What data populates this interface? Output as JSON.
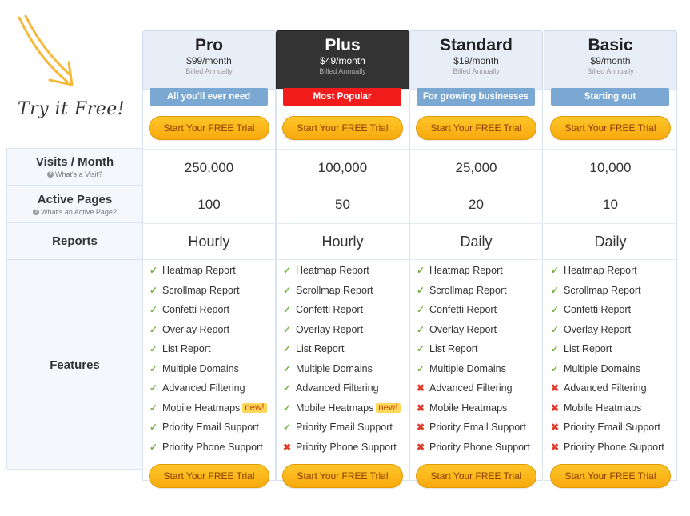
{
  "promo": {
    "text": "Try it Free!"
  },
  "row_labels": {
    "visits": {
      "title": "Visits / Month",
      "help": "What's a Visit?"
    },
    "pages": {
      "title": "Active Pages",
      "help": "What's an Active Page?"
    },
    "reports": {
      "title": "Reports"
    },
    "features": {
      "title": "Features"
    }
  },
  "colors": {
    "accent": "#f7a90d",
    "tagline_blue": "#7aa8d2",
    "popular_red": "#f21c1c",
    "check": "#76b043",
    "cross": "#e33a2b"
  },
  "plans": [
    {
      "name": "Pro",
      "price": "$99/month",
      "billed": "Billed Annually",
      "tagline": "All you'll ever need",
      "cta": "Start Your FREE Trial",
      "visits": "250,000",
      "pages": "100",
      "reports": "Hourly",
      "features": [
        {
          "label": "Heatmap Report",
          "included": true,
          "badge": ""
        },
        {
          "label": "Scrollmap Report",
          "included": true,
          "badge": ""
        },
        {
          "label": "Confetti Report",
          "included": true,
          "badge": ""
        },
        {
          "label": "Overlay Report",
          "included": true,
          "badge": ""
        },
        {
          "label": "List Report",
          "included": true,
          "badge": ""
        },
        {
          "label": "Multiple Domains",
          "included": true,
          "badge": ""
        },
        {
          "label": "Advanced Filtering",
          "included": true,
          "badge": ""
        },
        {
          "label": "Mobile Heatmaps",
          "included": true,
          "badge": "new!"
        },
        {
          "label": "Priority Email Support",
          "included": true,
          "badge": ""
        },
        {
          "label": "Priority Phone Support",
          "included": true,
          "badge": ""
        }
      ]
    },
    {
      "name": "Plus",
      "price": "$49/month",
      "billed": "Billed Annually",
      "tagline": "Most Popular",
      "cta": "Start Your FREE Trial",
      "visits": "100,000",
      "pages": "50",
      "reports": "Hourly",
      "features": [
        {
          "label": "Heatmap Report",
          "included": true,
          "badge": ""
        },
        {
          "label": "Scrollmap Report",
          "included": true,
          "badge": ""
        },
        {
          "label": "Confetti Report",
          "included": true,
          "badge": ""
        },
        {
          "label": "Overlay Report",
          "included": true,
          "badge": ""
        },
        {
          "label": "List Report",
          "included": true,
          "badge": ""
        },
        {
          "label": "Multiple Domains",
          "included": true,
          "badge": ""
        },
        {
          "label": "Advanced Filtering",
          "included": true,
          "badge": ""
        },
        {
          "label": "Mobile Heatmaps",
          "included": true,
          "badge": "new!"
        },
        {
          "label": "Priority Email Support",
          "included": true,
          "badge": ""
        },
        {
          "label": "Priority Phone Support",
          "included": false,
          "badge": ""
        }
      ]
    },
    {
      "name": "Standard",
      "price": "$19/month",
      "billed": "Billed Annually",
      "tagline": "For growing businesses",
      "cta": "Start Your FREE Trial",
      "visits": "25,000",
      "pages": "20",
      "reports": "Daily",
      "features": [
        {
          "label": "Heatmap Report",
          "included": true,
          "badge": ""
        },
        {
          "label": "Scrollmap Report",
          "included": true,
          "badge": ""
        },
        {
          "label": "Confetti Report",
          "included": true,
          "badge": ""
        },
        {
          "label": "Overlay Report",
          "included": true,
          "badge": ""
        },
        {
          "label": "List Report",
          "included": true,
          "badge": ""
        },
        {
          "label": "Multiple Domains",
          "included": true,
          "badge": ""
        },
        {
          "label": "Advanced Filtering",
          "included": false,
          "badge": ""
        },
        {
          "label": "Mobile Heatmaps",
          "included": false,
          "badge": ""
        },
        {
          "label": "Priority Email Support",
          "included": false,
          "badge": ""
        },
        {
          "label": "Priority Phone Support",
          "included": false,
          "badge": ""
        }
      ]
    },
    {
      "name": "Basic",
      "price": "$9/month",
      "billed": "Billed Annually",
      "tagline": "Starting out",
      "cta": "Start Your FREE Trial",
      "visits": "10,000",
      "pages": "10",
      "reports": "Daily",
      "features": [
        {
          "label": "Heatmap Report",
          "included": true,
          "badge": ""
        },
        {
          "label": "Scrollmap Report",
          "included": true,
          "badge": ""
        },
        {
          "label": "Confetti Report",
          "included": true,
          "badge": ""
        },
        {
          "label": "Overlay Report",
          "included": true,
          "badge": ""
        },
        {
          "label": "List Report",
          "included": true,
          "badge": ""
        },
        {
          "label": "Multiple Domains",
          "included": true,
          "badge": ""
        },
        {
          "label": "Advanced Filtering",
          "included": false,
          "badge": ""
        },
        {
          "label": "Mobile Heatmaps",
          "included": false,
          "badge": ""
        },
        {
          "label": "Priority Email Support",
          "included": false,
          "badge": ""
        },
        {
          "label": "Priority Phone Support",
          "included": false,
          "badge": ""
        }
      ]
    }
  ]
}
